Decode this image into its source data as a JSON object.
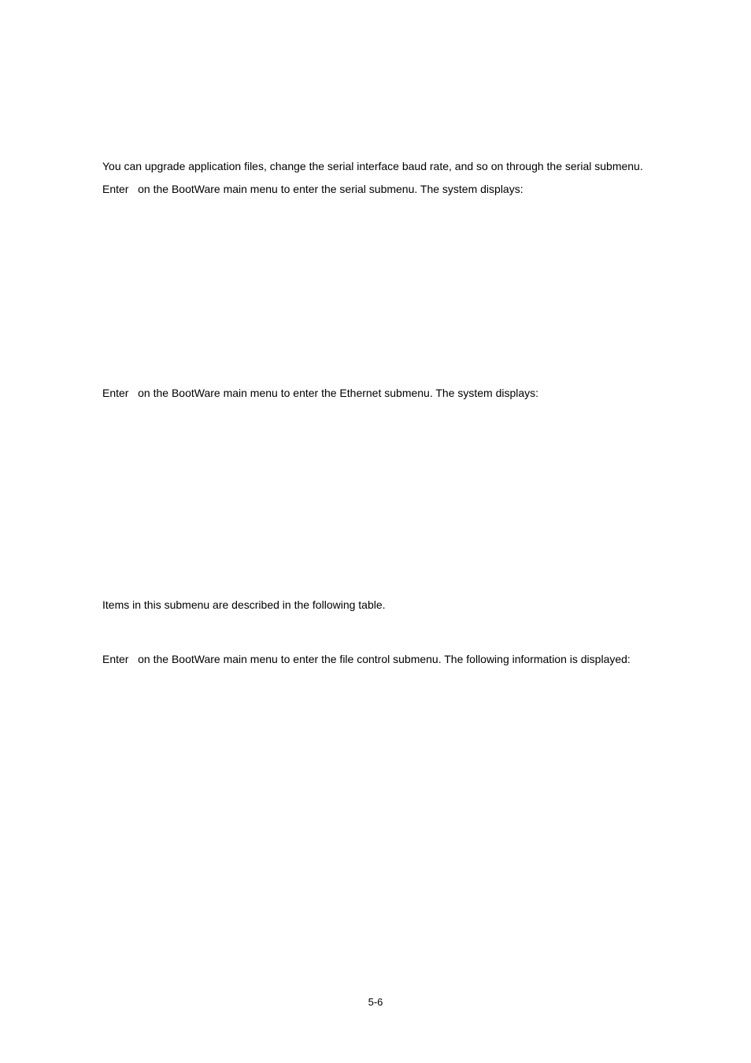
{
  "p1": "You can upgrade application files, change the serial interface baud rate, and so on through the serial submenu.",
  "p2_a": "Enter",
  "p2_b": "on the BootWare main menu to enter the serial submenu. The system displays:",
  "p3_a": "Enter",
  "p3_b": "on the BootWare main menu to enter the Ethernet submenu. The system displays:",
  "p4": "Items in this submenu are described in the following table.",
  "p5_a": "Enter",
  "p5_b": "on the BootWare main menu to enter the file control submenu. The following information is displayed:",
  "footer": "5-6"
}
